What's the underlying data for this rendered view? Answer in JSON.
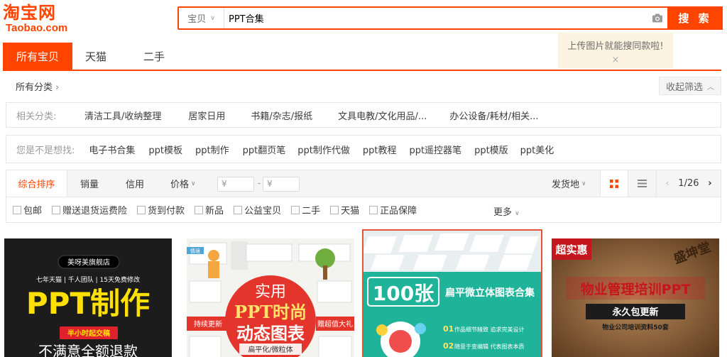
{
  "logo": {
    "cn": "淘宝网",
    "en": "Taobao.com"
  },
  "search": {
    "category": "宝贝",
    "query": "PPT合集",
    "button": "搜 索",
    "camera_icon": "camera-icon"
  },
  "image_tip": {
    "text": "上传图片就能搜同款啦!",
    "close": "×"
  },
  "tabs": [
    {
      "label": "所有宝贝",
      "active": true
    },
    {
      "label": "天猫"
    },
    {
      "label": "二手"
    }
  ],
  "category_row": {
    "all": "所有分类",
    "collapse": "收起筛选"
  },
  "related": {
    "label": "相关分类:",
    "items": [
      "清洁工具/收纳整理",
      "居家日用",
      "书籍/杂志/报纸",
      "文具电教/文化用品/...",
      "办公设备/耗材/相关..."
    ]
  },
  "suggest": {
    "label": "您是不是想找:",
    "items": [
      "电子书合集",
      "ppt模板",
      "ppt制作",
      "ppt翻页笔",
      "ppt制作代做",
      "ppt教程",
      "ppt遥控器笔",
      "ppt模版",
      "ppt美化"
    ]
  },
  "sort": {
    "items": [
      "综合排序",
      "销量",
      "信用",
      "价格"
    ],
    "price_from": "¥",
    "price_to": "¥",
    "dash": "-",
    "ship_from": "发货地",
    "page": "1/26"
  },
  "filters": [
    "包邮",
    "赠送退货运费险",
    "货到付款",
    "新品",
    "公益宝贝",
    "二手",
    "天猫",
    "正品保障"
  ],
  "more": "更多",
  "products": [
    {
      "shop": "美呀美旗舰店",
      "tagline": "七年天猫 | 千人团队 | 15天免费修改",
      "headline": "PPT制作",
      "badge": "半小时起交稿",
      "slogan": "不满意全额退款"
    },
    {
      "corner": "情境",
      "ribbon_left": "持续更新",
      "ribbon_right": "赠超值大礼",
      "big1": "实用",
      "big2": "PPT时尚",
      "big3": "动态图表",
      "sub": "扁平化/微粒体"
    },
    {
      "big": "100张",
      "title": "扁平微立体图表合集",
      "line1": "作品细节精致 追求完美设计",
      "line2": "随意于变编辑 代表图表本质",
      "num1": "01",
      "num2": "02"
    },
    {
      "badge": "超实惠",
      "stamp": "盛坤堂",
      "title": "物业管理培训PPT",
      "sub": "永久包更新",
      "foot": "物业公司培训资料50套"
    }
  ],
  "colors": {
    "accent": "#ff4400",
    "tip_bg": "#fdf3e1"
  }
}
